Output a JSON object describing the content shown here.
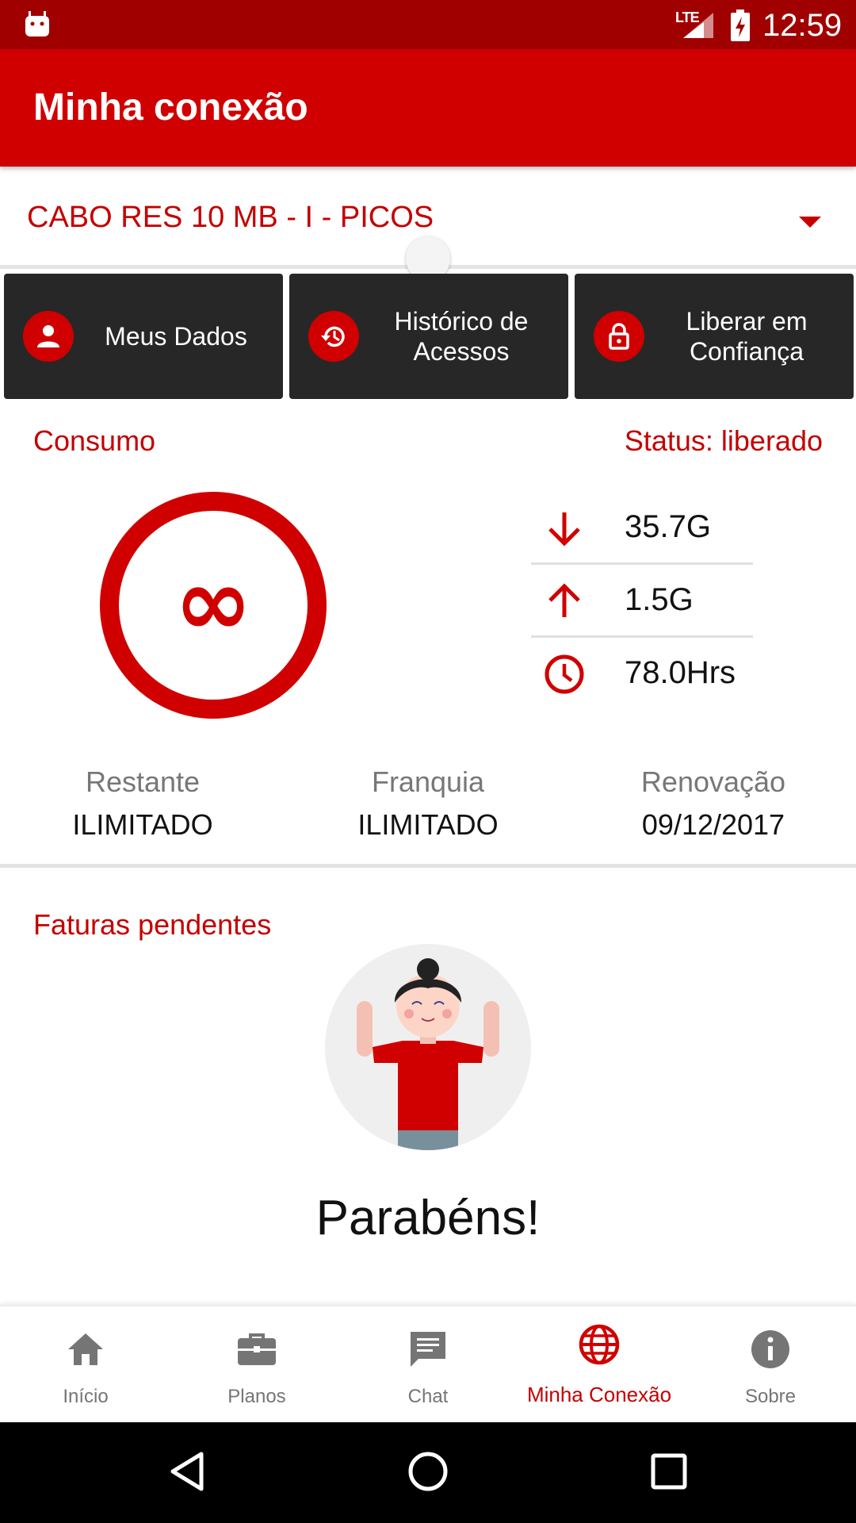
{
  "status_bar": {
    "time": "12:59",
    "network": "LTE"
  },
  "app_bar": {
    "title": "Minha conexão"
  },
  "plan_selector": {
    "value": "CABO RES 10 MB - I - PICOS"
  },
  "actions": [
    {
      "label": "Meus Dados",
      "icon": "person-icon"
    },
    {
      "label": "Histórico de\nAcessos",
      "icon": "history-icon"
    },
    {
      "label": "Liberar em\nConfiança",
      "icon": "lock-icon"
    }
  ],
  "consumo": {
    "title": "Consumo",
    "status": "Status: liberado",
    "gauge_symbol": "∞",
    "download": "35.7G",
    "upload": "1.5G",
    "hours": "78.0Hrs"
  },
  "stats": [
    {
      "label": "Restante",
      "value": "ILIMITADO"
    },
    {
      "label": "Franquia",
      "value": "ILIMITADO"
    },
    {
      "label": "Renovação",
      "value": "09/12/2017"
    }
  ],
  "faturas": {
    "title": "Faturas pendentes",
    "message": "Parabéns!"
  },
  "bottom_nav": [
    {
      "label": "Início",
      "icon": "home-icon"
    },
    {
      "label": "Planos",
      "icon": "briefcase-icon"
    },
    {
      "label": "Chat",
      "icon": "chat-icon"
    },
    {
      "label": "Minha Conexão",
      "icon": "globe-icon",
      "active": true
    },
    {
      "label": "Sobre",
      "icon": "info-icon"
    }
  ],
  "colors": {
    "primary": "#d00000",
    "primary_dark": "#a10000",
    "accent_text": "#c40000",
    "button_bg": "#272727",
    "nav_inactive": "#757575"
  }
}
